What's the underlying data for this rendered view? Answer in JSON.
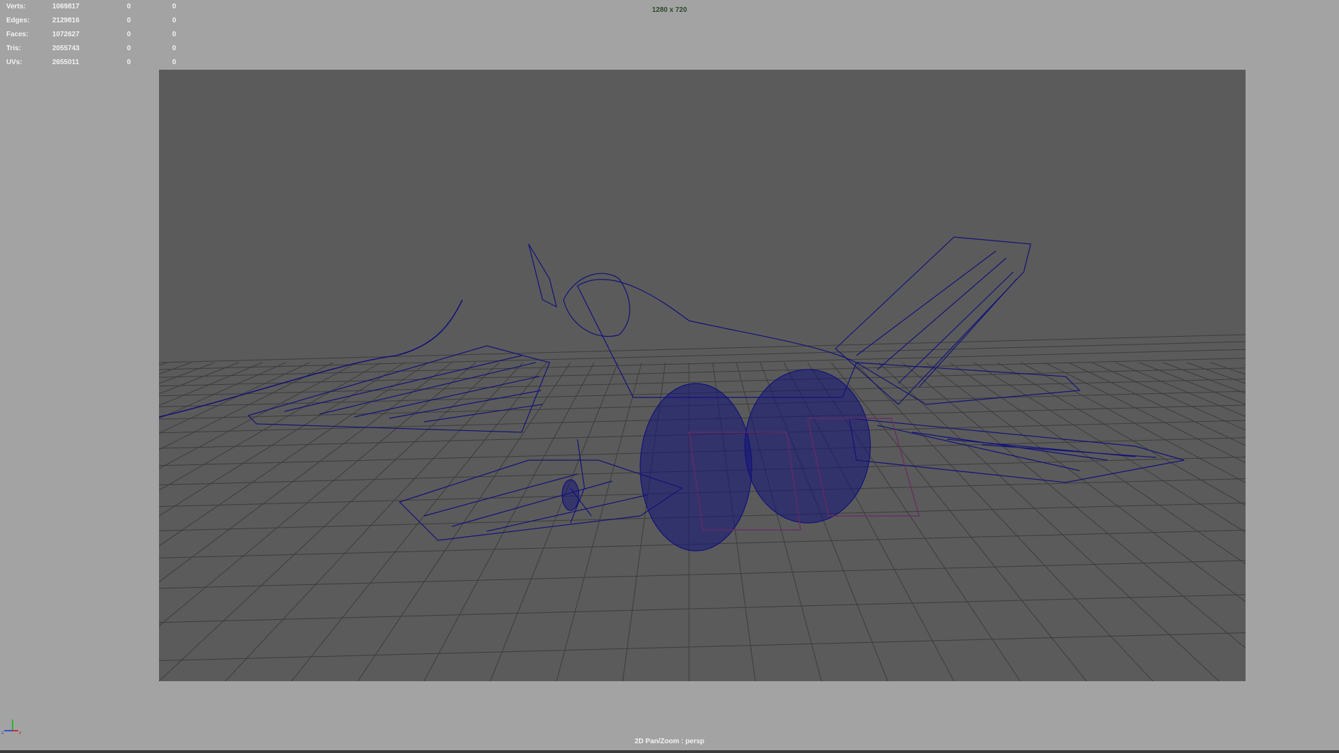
{
  "stats": {
    "rows": [
      {
        "label": "Verts:",
        "value": "1069817",
        "selected": "0",
        "extra": "0"
      },
      {
        "label": "Edges:",
        "value": "2129816",
        "selected": "0",
        "extra": "0"
      },
      {
        "label": "Faces:",
        "value": "1072627",
        "selected": "0",
        "extra": "0"
      },
      {
        "label": "Tris:",
        "value": "2055743",
        "selected": "0",
        "extra": "0"
      },
      {
        "label": "UVs:",
        "value": "2655011",
        "selected": "0",
        "extra": "0"
      }
    ]
  },
  "viewport": {
    "resolution": "1280 x 720",
    "camera_label": "2D Pan/Zoom : persp",
    "axis_labels": {
      "y": "y",
      "z": "z",
      "x": "x"
    }
  },
  "colors": {
    "panel_bg": "#a3a3a3",
    "gate_bg": "#5b5b5b",
    "wireframe": "#12127a",
    "grid": "#3c3c3c",
    "axis_x": "#c83030",
    "axis_y": "#30b030",
    "axis_z": "#3050d0"
  },
  "icons": {
    "axis_gizmo": "xyz-axis-icon"
  }
}
